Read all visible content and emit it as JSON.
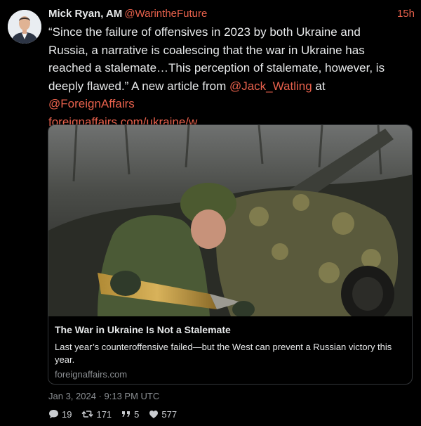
{
  "tweet": {
    "author_name": "Mick Ryan, AM",
    "handle": "@WarintheFuture",
    "time_ago": "15h",
    "text_1": "“Since the failure of offensives in 2023 by both Ukraine and Russia, a narrative is coalescing that the war in Ukraine has reached a stalemate…This perception of stalemate, however, is deeply flawed.” A new article from ",
    "mention_1": "@Jack_Watling",
    "text_2": " at ",
    "mention_2": "@ForeignAffairs",
    "url": "foreignaffairs.com/ukraine/w…",
    "timestamp": "Jan 3, 2024 · 9:13 PM UTC"
  },
  "card": {
    "title": "The War in Ukraine Is Not a Stalemate",
    "description": "Last year’s counteroffensive failed—but the West can prevent a Russian victory this year.",
    "domain": "foreignaffairs.com"
  },
  "stats": {
    "replies": "19",
    "retweets": "171",
    "quotes": "5",
    "likes": "577"
  },
  "colors": {
    "background": "#000000",
    "accent": "#e8614c",
    "text": "#e7e9ea",
    "muted": "#8b8f93",
    "border": "#333639"
  },
  "icons": [
    "avatar-photo",
    "reply-icon",
    "retweet-icon",
    "quote-icon",
    "heart-icon"
  ]
}
